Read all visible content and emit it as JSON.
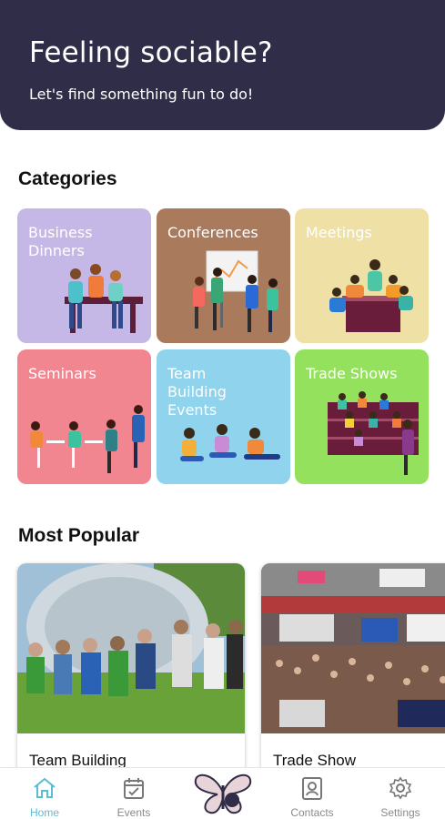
{
  "hero": {
    "title": "Feeling sociable?",
    "subtitle": "Let's find something fun to do!",
    "background_color": "#302d48"
  },
  "categories_section": {
    "title": "Categories",
    "tiles": [
      {
        "label": "Business\nDinners",
        "color": "#c6b8e6"
      },
      {
        "label": "Conferences",
        "color": "#a97a5c"
      },
      {
        "label": "Meetings",
        "color": "#efe0a6"
      },
      {
        "label": "Seminars",
        "color": "#f18590"
      },
      {
        "label": "Team\nBuilding\nEvents",
        "color": "#8fd3ec"
      },
      {
        "label": "Trade Shows",
        "color": "#93e15c"
      }
    ]
  },
  "popular_section": {
    "title": "Most Popular",
    "cards": [
      {
        "label": "Team Building"
      },
      {
        "label": "Trade Show"
      }
    ]
  },
  "bottom_nav": {
    "items": [
      {
        "label": "Home",
        "icon": "home-icon",
        "active": true
      },
      {
        "label": "Events",
        "icon": "calendar-icon",
        "active": false
      },
      {
        "label": "Contacts",
        "icon": "contact-card-icon",
        "active": false
      },
      {
        "label": "Settings",
        "icon": "gear-icon",
        "active": false
      }
    ],
    "center_logo": "butterfly-logo",
    "active_color": "#5bbcd4"
  }
}
